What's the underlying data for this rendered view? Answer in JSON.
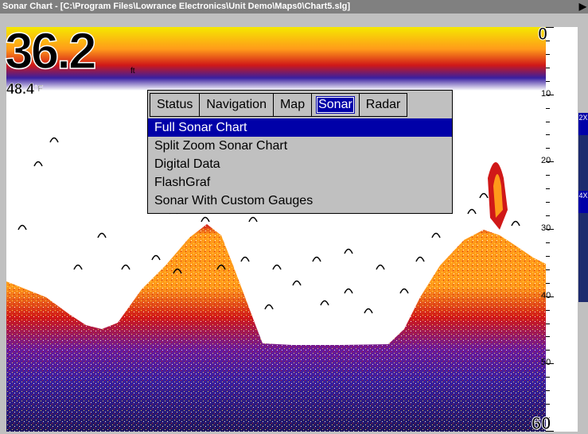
{
  "window": {
    "title": "Sonar Chart - [C:\\Program Files\\Lowrance Electronics\\Unit Demo\\Maps0\\Chart5.slg]",
    "arrow": "▶"
  },
  "readout": {
    "depth": "36.2",
    "depth_unit": "ft",
    "temperature": "48.4",
    "temperature_unit": "°F"
  },
  "depth_scale": {
    "labels": [
      "0",
      "10",
      "20",
      "30",
      "40",
      "50",
      "60"
    ],
    "top_label": "0",
    "bottom_label": "60"
  },
  "zoom_badges": [
    "2X",
    "4X"
  ],
  "menu": {
    "tabs": [
      {
        "label": "Status",
        "active": false
      },
      {
        "label": "Navigation",
        "active": false
      },
      {
        "label": "Map",
        "active": false
      },
      {
        "label": "Sonar",
        "active": true
      },
      {
        "label": "Radar",
        "active": false
      }
    ],
    "items": [
      {
        "label": "Full Sonar Chart",
        "selected": true
      },
      {
        "label": "Split Zoom Sonar Chart",
        "selected": false
      },
      {
        "label": "Digital Data",
        "selected": false
      },
      {
        "label": "FlashGraf",
        "selected": false
      },
      {
        "label": "Sonar With Custom Gauges",
        "selected": false
      }
    ]
  },
  "colors": {
    "surface_yellow": "#f5e800",
    "bottom_orange": "#ff9a1a",
    "bottom_red": "#d01818",
    "bottom_purple": "#3a1fa0",
    "bottom_navy": "#1d1660",
    "menu_highlight": "#0000a8",
    "panel_gray": "#c0c0c0"
  }
}
